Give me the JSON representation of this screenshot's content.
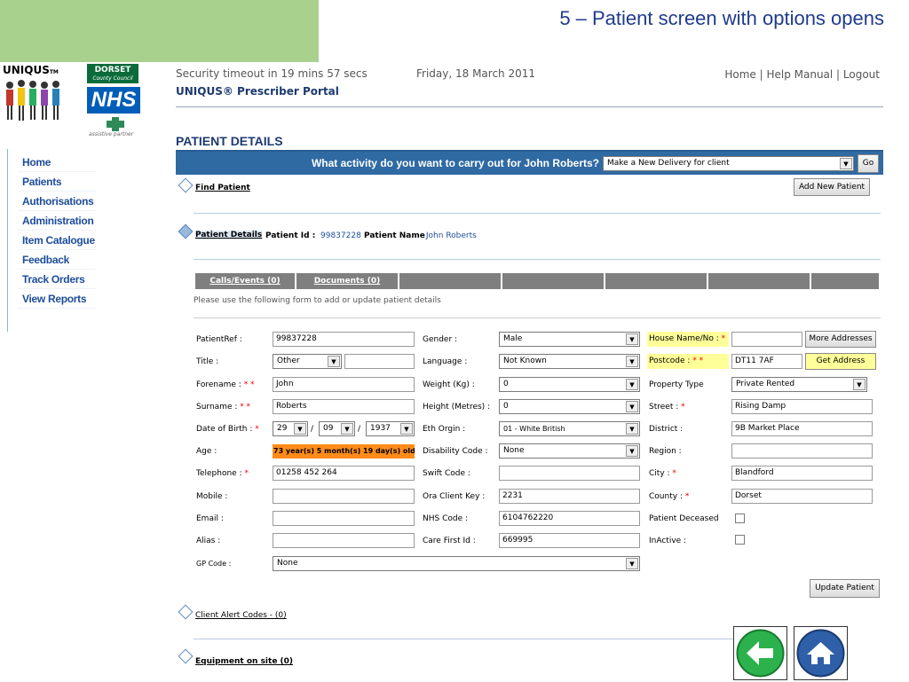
{
  "slide_title": "5 – Patient screen with options opens",
  "logos": {
    "uniqus": "UNIQUS",
    "dorset": "DORSET",
    "dorset_sub": "County Council",
    "nhs": "NHS",
    "assist": "assistive partner"
  },
  "nav": [
    "Home",
    "Patients",
    "Authorisations",
    "Administration",
    "Item Catalogue",
    "Feedback",
    "Track Orders",
    "View Reports"
  ],
  "header": {
    "timeout": "Security timeout in 19 mins 57 secs",
    "date": "Friday, 18 March 2011",
    "home": "Home",
    "sep1": " | ",
    "help": "Help Manual",
    "sep2": " | ",
    "logout": "Logout",
    "portal": "UNIQUS® Prescriber Portal"
  },
  "page_title": "PATIENT DETAILS",
  "activity": {
    "question": "What activity do you want to carry out for John Roberts?",
    "selected": "Make a New Delivery for client",
    "go": "Go"
  },
  "find_patient": "Find Patient",
  "add_new_patient": "Add New Patient",
  "patient_details": {
    "link": "Patient Details",
    "id_label": "Patient Id",
    "id_value": "99837228",
    "name_label": "Patient Name",
    "name_value": ": John Roberts"
  },
  "tabs": [
    "Calls/Events (0)",
    "Documents (0)"
  ],
  "note": "Please use the following form to add or update patient details",
  "form": {
    "patientref_label": "PatientRef :",
    "patientref": "99837228",
    "title_label": "Title :",
    "title": "Other",
    "forename_label": "Forename :",
    "forename": "John",
    "surname_label": "Surname :",
    "surname": "Roberts",
    "dob_label": "Date of Birth :",
    "dob_day": "29",
    "dob_month": "09",
    "dob_year": "1937",
    "dob_sep": "/",
    "age_label": "Age :",
    "age": "73 year(s) 5 month(s) 19 day(s) old.",
    "telephone_label": "Telephone :",
    "telephone": "01258 452 264",
    "mobile_label": "Mobile :",
    "email_label": "Email :",
    "alias_label": "Alias :",
    "gp_label": "GP Code :",
    "gp": "None",
    "gender_label": "Gender :",
    "gender": "Male",
    "language_label": "Language :",
    "language": "Not Known",
    "weight_label": "Weight (Kg) :",
    "weight": "0",
    "height_label": "Height (Metres) :",
    "height": "0",
    "eth_label": "Eth Orgin :",
    "eth": "01 - White British",
    "disability_label": "Disability Code :",
    "disability": "None",
    "swift_label": "Swift Code :",
    "ora_label": "Ora Client Key :",
    "ora": "2231",
    "nhs_label": "NHS Code :",
    "nhs": "6104762220",
    "carefirst_label": "Care First Id :",
    "carefirst": "669995",
    "house_label": "House Name/No :",
    "more_addresses": "More Addresses",
    "postcode_label": "Postcode :",
    "postcode": "DT11 7AF",
    "get_address": "Get Address",
    "property_label": "Property Type",
    "property": "Private Rented",
    "street_label": "Street :",
    "street": "Rising Damp",
    "district_label": "District :",
    "district": "9B Market Place",
    "region_label": "Region :",
    "city_label": "City :",
    "city": "Blandford",
    "county_label": "County :",
    "county": "Dorset",
    "deceased_label": "Patient Deceased",
    "inactive_label": "InActive :",
    "req1": " *",
    "req2": " * *",
    "colon": " :"
  },
  "update_patient": "Update Patient",
  "client_alert": "Client Alert Codes - (0)",
  "equipment": "Equipment on site (0)"
}
